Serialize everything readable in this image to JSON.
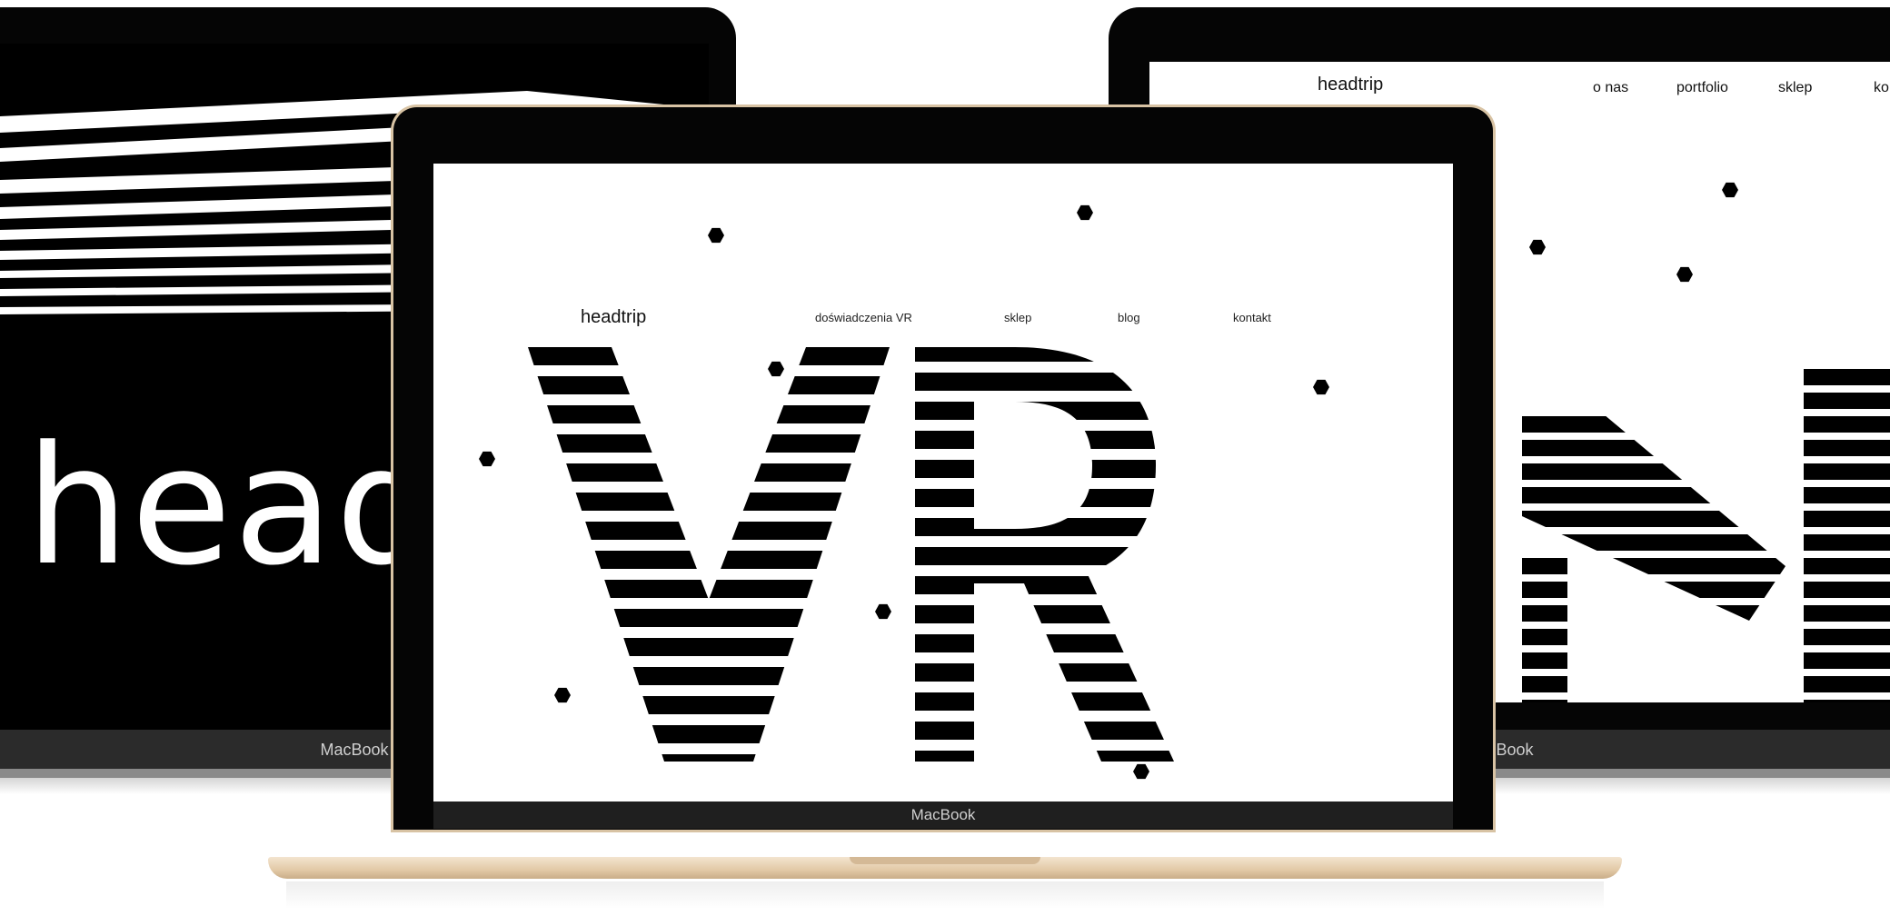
{
  "left_laptop": {
    "hero_text": "headt",
    "brand": "MacBook"
  },
  "right_laptop": {
    "logo": "headtrip",
    "nav": [
      "o nas",
      "portfolio",
      "sklep",
      "ko"
    ],
    "brand": "MacBook"
  },
  "center_laptop": {
    "logo": "headtrip",
    "nav": [
      "doświadczenia VR",
      "sklep",
      "blog",
      "kontakt"
    ],
    "hero_text": "VR",
    "brand": "MacBook"
  },
  "colors": {
    "screen_bg": "#ffffff",
    "ink": "#000000",
    "gold_base": "#e9d3b6"
  }
}
